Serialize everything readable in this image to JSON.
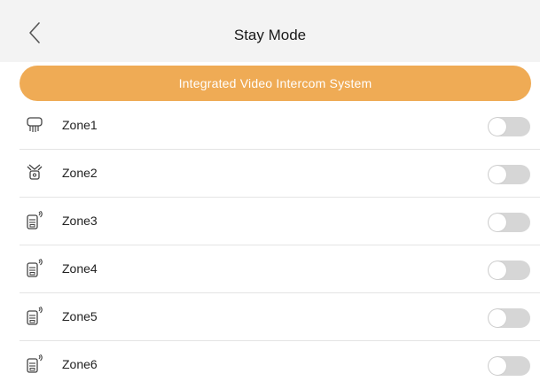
{
  "header": {
    "title": "Stay Mode",
    "back_icon": "chevron-left-icon"
  },
  "banner": {
    "text": "Integrated Video Intercom System",
    "color": "#efab55"
  },
  "zones": [
    {
      "label": "Zone1",
      "icon": "shower-sensor-icon",
      "enabled": false
    },
    {
      "label": "Zone2",
      "icon": "motion-detector-icon",
      "enabled": false
    },
    {
      "label": "Zone3",
      "icon": "wireless-sensor-icon",
      "enabled": false
    },
    {
      "label": "Zone4",
      "icon": "wireless-sensor-icon",
      "enabled": false
    },
    {
      "label": "Zone5",
      "icon": "wireless-sensor-icon",
      "enabled": false
    },
    {
      "label": "Zone6",
      "icon": "wireless-sensor-icon",
      "enabled": false
    }
  ],
  "colors": {
    "header_bg": "#f3f3f3",
    "toggle_off": "#d6d6d6"
  }
}
